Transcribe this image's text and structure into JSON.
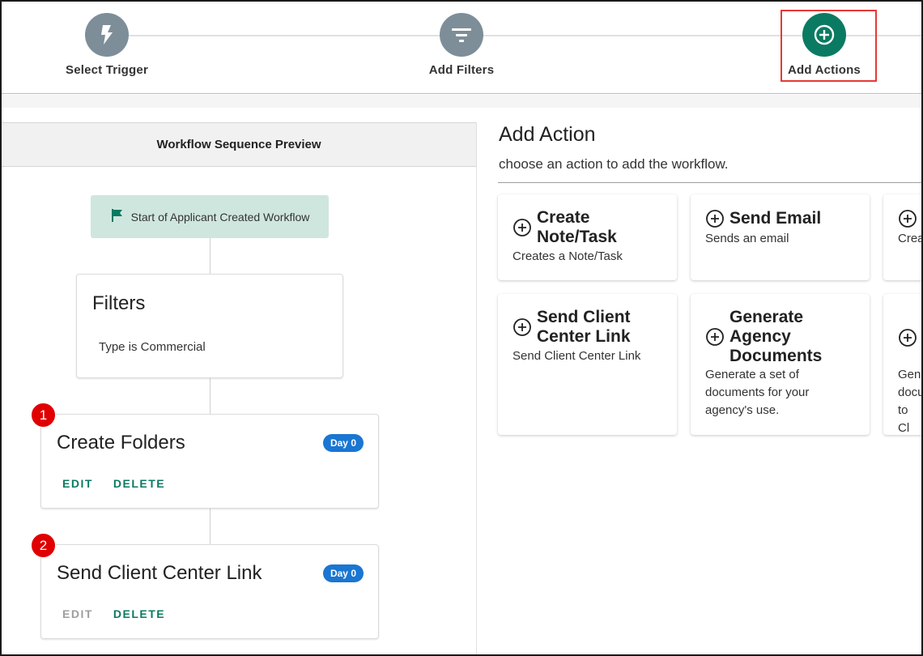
{
  "stepper": {
    "steps": [
      {
        "label": "Select Trigger",
        "icon": "lightning-bolt-icon",
        "color": "#7d8e99"
      },
      {
        "label": "Add Filters",
        "icon": "filter-icon",
        "color": "#7d8e99"
      },
      {
        "label": "Add Actions",
        "icon": "plus-circle-icon",
        "color": "#0b7a62"
      }
    ]
  },
  "preview": {
    "header": "Workflow Sequence Preview",
    "start_label": "Start of Applicant Created Workflow",
    "filters": {
      "title": "Filters",
      "condition": "Type is Commercial"
    },
    "actions": [
      {
        "number": "1",
        "title": "Create Folders",
        "badge": "Day 0",
        "edit": "EDIT",
        "delete": "DELETE"
      },
      {
        "number": "2",
        "title": "Send Client Center Link",
        "badge": "Day 0",
        "edit": "EDIT",
        "delete": "DELETE"
      }
    ]
  },
  "add_action": {
    "title": "Add Action",
    "subtitle": "choose an action to add the workflow.",
    "tiles": [
      {
        "name_lines": [
          "Create",
          "Note/Task"
        ],
        "desc": "Creates a Note/Task"
      },
      {
        "name_lines": [
          "Send Email"
        ],
        "desc": "Sends an email"
      },
      {
        "name_lines": [],
        "desc": "Crea"
      },
      {
        "name_lines": [
          "Send Client",
          "Center Link"
        ],
        "desc": "Send Client Center Link"
      },
      {
        "name_lines": [
          "Generate",
          "Agency",
          "Documents"
        ],
        "desc": "Generate a set of documents for your agency's use."
      },
      {
        "name_lines": [],
        "desc": "Gene docu to Cl"
      }
    ]
  },
  "colors": {
    "accent": "#0b7a62",
    "badge_blue": "#1976d2",
    "highlight_red": "#e53935",
    "number_red": "#e00000"
  }
}
